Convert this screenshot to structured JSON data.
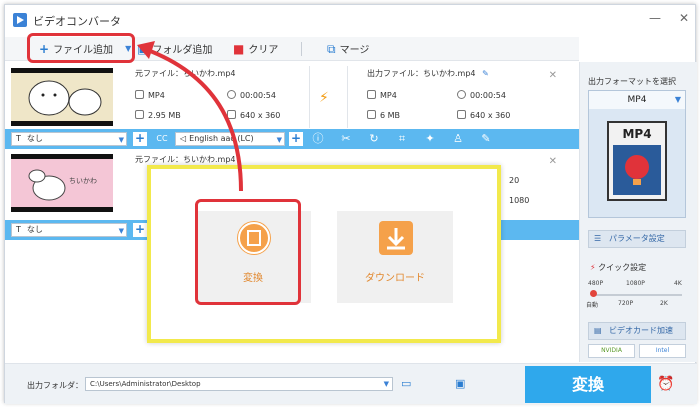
{
  "window": {
    "title": "ビデオコンバータ"
  },
  "toolbar": {
    "add_file": "ファイル追加",
    "add_folder": "フォルダ追加",
    "clear": "クリア",
    "merge": "マージ"
  },
  "rows": [
    {
      "src_label": "元ファイル：",
      "src_name": "ちいかわ.mp4",
      "format": "MP4",
      "duration": "00:00:54",
      "size": "2.95 MB",
      "resolution": "640 x 360",
      "out_label": "出力ファイル：",
      "out_name": "ちいかわ.mp4",
      "out_format": "MP4",
      "out_duration": "00:00:54",
      "out_size": "6 MB",
      "out_resolution": "640 x 360"
    },
    {
      "src_label": "元ファイル：",
      "src_name": "ちいかわ.mp4",
      "partial_a": "20",
      "partial_b": "1080",
      "thumb_caption": "ちいかわ"
    }
  ],
  "edit_bar": {
    "subtitle": "なし",
    "audio": "English aac (LC)",
    "subtitle2": "なし"
  },
  "right_panel": {
    "title": "出力フォーマットを選択",
    "format": "MP4",
    "format_image_label": "MP4",
    "param_button": "パラメータ設定",
    "quick_label": "クイック設定",
    "ticks_top": [
      "480P",
      "1080P",
      "4K"
    ],
    "ticks_bottom": [
      "自動",
      "720P",
      "2K"
    ],
    "hw_button": "ビデオカード加速",
    "hw_tags": [
      "NVIDIA",
      "Intel"
    ]
  },
  "bottom": {
    "output_folder_label": "出力フォルダ：",
    "output_folder_path": "C:\\Users\\Administrator\\Desktop",
    "convert_label": "変換"
  },
  "dialog": {
    "convert_label": "変換",
    "download_label": "ダウンロード"
  },
  "colors": {
    "accent": "#2fa8ec",
    "edit_bar": "#5cb8f0",
    "highlight_red": "#e0333a",
    "highlight_yellow": "#f2e94c",
    "tile_orange": "#f5a14a"
  }
}
